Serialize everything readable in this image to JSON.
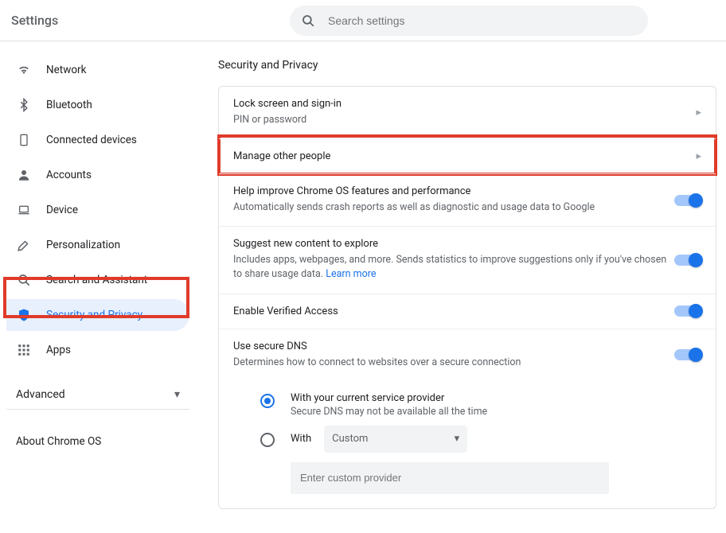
{
  "header": {
    "title": "Settings",
    "search_placeholder": "Search settings"
  },
  "sidebar": {
    "items": [
      {
        "id": "network",
        "label": "Network"
      },
      {
        "id": "bluetooth",
        "label": "Bluetooth"
      },
      {
        "id": "devices",
        "label": "Connected devices"
      },
      {
        "id": "accounts",
        "label": "Accounts"
      },
      {
        "id": "device",
        "label": "Device"
      },
      {
        "id": "personal",
        "label": "Personalization"
      },
      {
        "id": "search",
        "label": "Search and Assistant"
      },
      {
        "id": "security",
        "label": "Security and Privacy"
      },
      {
        "id": "apps",
        "label": "Apps"
      }
    ],
    "advanced": "Advanced",
    "about": "About Chrome OS"
  },
  "security": {
    "heading": "Security and Privacy",
    "lock": {
      "title": "Lock screen and sign-in",
      "sub": "PIN or password"
    },
    "manage": {
      "title": "Manage other people"
    },
    "crash": {
      "title": "Help improve Chrome OS features and performance",
      "sub": "Automatically sends crash reports as well as diagnostic and usage data to Google"
    },
    "suggest": {
      "title": "Suggest new content to explore",
      "sub": "Includes apps, webpages, and more. Sends statistics to improve suggestions only if you've chosen to share usage data.  ",
      "link": "Learn more"
    },
    "verified": {
      "title": "Enable Verified Access"
    },
    "dns": {
      "title": "Use secure DNS",
      "sub": "Determines how to connect to websites over a secure connection",
      "opt_current": {
        "title": "With your current service provider",
        "sub": "Secure DNS may not be available all the time"
      },
      "opt_custom": {
        "label": "With",
        "select": "Custom",
        "placeholder": "Enter custom provider"
      }
    }
  }
}
